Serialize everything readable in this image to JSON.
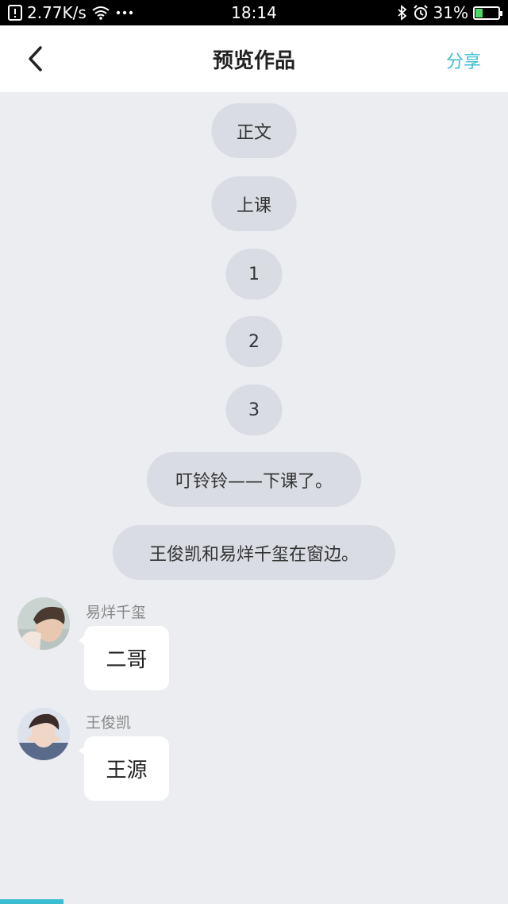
{
  "status_bar": {
    "speed": "2.77K/s",
    "time": "18:14",
    "battery": "31%",
    "battery_level": 0.31
  },
  "header": {
    "title": "预览作品",
    "share_label": "分享"
  },
  "center_bubbles": [
    "正文",
    "上课",
    "1",
    "2",
    "3",
    "叮铃铃——下课了。",
    "王俊凯和易烊千玺在窗边。"
  ],
  "messages": [
    {
      "sender": "易烊千玺",
      "text": "二哥"
    },
    {
      "sender": "王俊凯",
      "text": "王源"
    }
  ]
}
